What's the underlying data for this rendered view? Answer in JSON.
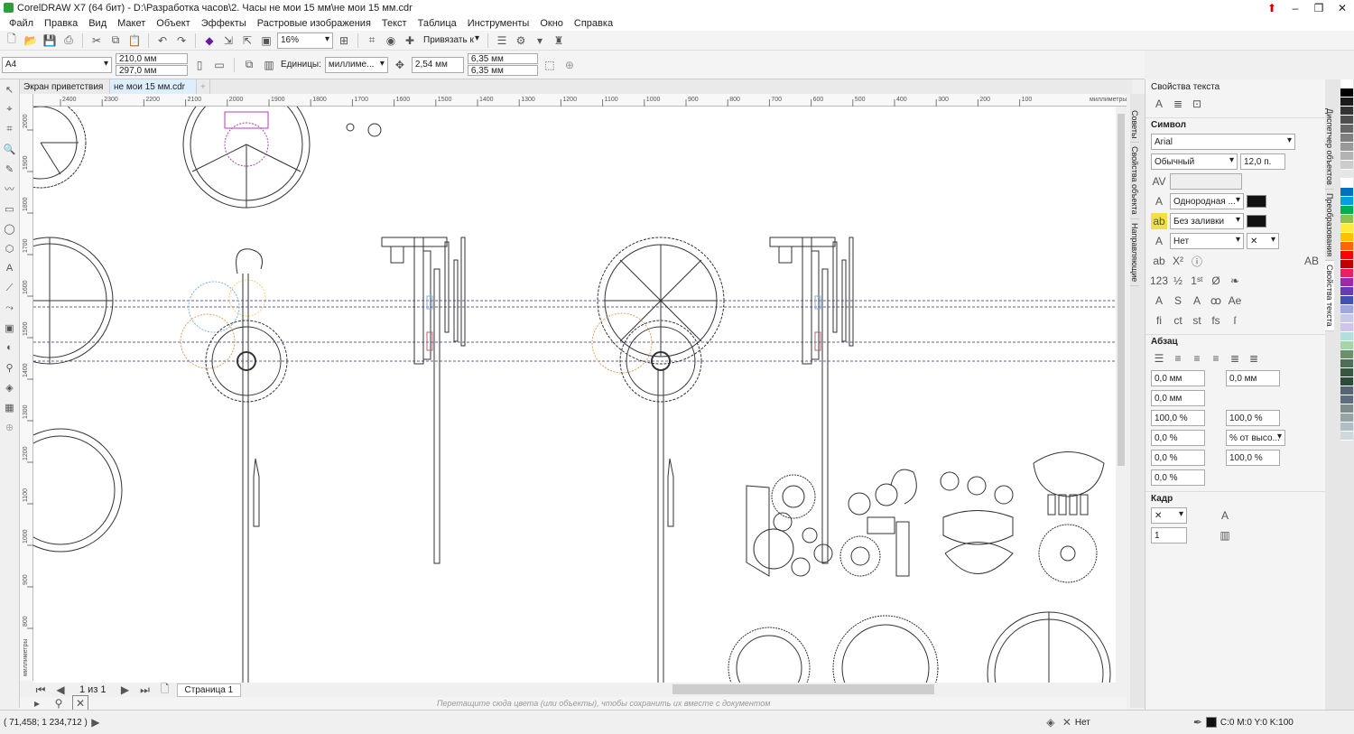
{
  "title": "CorelDRAW X7 (64 бит) - D:\\Разработка часов\\2. Часы не мои 15 мм\\не мои 15 мм.cdr",
  "menu": [
    "Файл",
    "Правка",
    "Вид",
    "Макет",
    "Объект",
    "Эффекты",
    "Растровые изображения",
    "Текст",
    "Таблица",
    "Инструменты",
    "Окно",
    "Справка"
  ],
  "toolbar": {
    "zoom": "16%",
    "snap": "Привязать к"
  },
  "propbar": {
    "page_size": "A4",
    "width": "210,0 мм",
    "height": "297,0 мм",
    "units_label": "Единицы:",
    "units": "миллиме...",
    "nudge": "2,54 мм",
    "dup_x": "6,35 мм",
    "dup_y": "6,35 мм"
  },
  "doc_tabs": [
    "Экран приветствия",
    "не мои 15 мм.cdr"
  ],
  "ruler": {
    "h_ticks": [
      "2400",
      "2300",
      "2200",
      "2100",
      "2000",
      "1900",
      "1800",
      "1700",
      "1600",
      "1500",
      "1400",
      "1300",
      "1200",
      "1100",
      "1000",
      "900",
      "800",
      "700",
      "600",
      "500",
      "400",
      "300",
      "200",
      "100"
    ],
    "h_unit": "миллиметры",
    "v_ticks": [
      "2000",
      "1900",
      "1800",
      "1700",
      "1600",
      "1500",
      "1400",
      "1300",
      "1200",
      "1100",
      "1000",
      "900",
      "800"
    ],
    "v_unit": "миллиметры"
  },
  "pagebar": {
    "page_of": "1 из 1",
    "page_name": "Страница 1"
  },
  "palette_hint": "Перетащите сюда цвета (или объекты), чтобы сохранить их вместе с документом",
  "side_tabs": [
    "Советы",
    "Свойства объекта",
    "Направляющие"
  ],
  "right_tabs": [
    "Диспетчер объектов",
    "Преобразования",
    "Свойства текста"
  ],
  "panel": {
    "title": "Свойства текста",
    "sec_symbol": "Символ",
    "font": "Arial",
    "style": "Обычный",
    "size": "12,0 п.",
    "fill": "Однородная ...",
    "bg_fill": "Без заливки",
    "outline": "Нет",
    "sec_para": "Абзац",
    "p1": "0,0 мм",
    "p2": "0,0 мм",
    "p3": "0,0 мм",
    "p4": "100,0 %",
    "p5": "100,0 %",
    "p6": "0,0 %",
    "p7": "% от высо...",
    "p8": "0,0 %",
    "p9": "100,0 %",
    "p10": "0,0 %",
    "sec_frame": "Кадр",
    "cols": "1"
  },
  "status": {
    "coords": "( 71,458; 1 234,712 )",
    "fill_none": "Нет",
    "cmyk": "C:0 M:0 Y:0 K:100"
  },
  "palette_colors": [
    "#ffffff",
    "#000000",
    "#1a1a1a",
    "#333333",
    "#4d4d4d",
    "#666666",
    "#808080",
    "#999999",
    "#b3b3b3",
    "#cccccc",
    "#e6e6e6",
    "#ffffff",
    "#0070c0",
    "#00a0e0",
    "#00b050",
    "#8bc34a",
    "#ffeb3b",
    "#ffc000",
    "#ff6600",
    "#ff0000",
    "#c00000",
    "#e91e63",
    "#9c27b0",
    "#673ab7",
    "#3f51b5",
    "#9fa8da",
    "#c5cae9",
    "#d1c4e9",
    "#b2dfdb",
    "#a5d6a7",
    "#6d8f6d",
    "#4e6e58",
    "#38553f",
    "#2b4a3a",
    "#566573",
    "#5d6d7e",
    "#7f8c8d",
    "#95a5a6",
    "#b0bec5",
    "#cfd8dc"
  ],
  "colors": {
    "accent": "#2e9d3a",
    "guide": "#2b2b80",
    "gear_magenta": "#b040b0",
    "gear_orange": "#e0a060",
    "gear_blue": "#7ab0e0"
  }
}
